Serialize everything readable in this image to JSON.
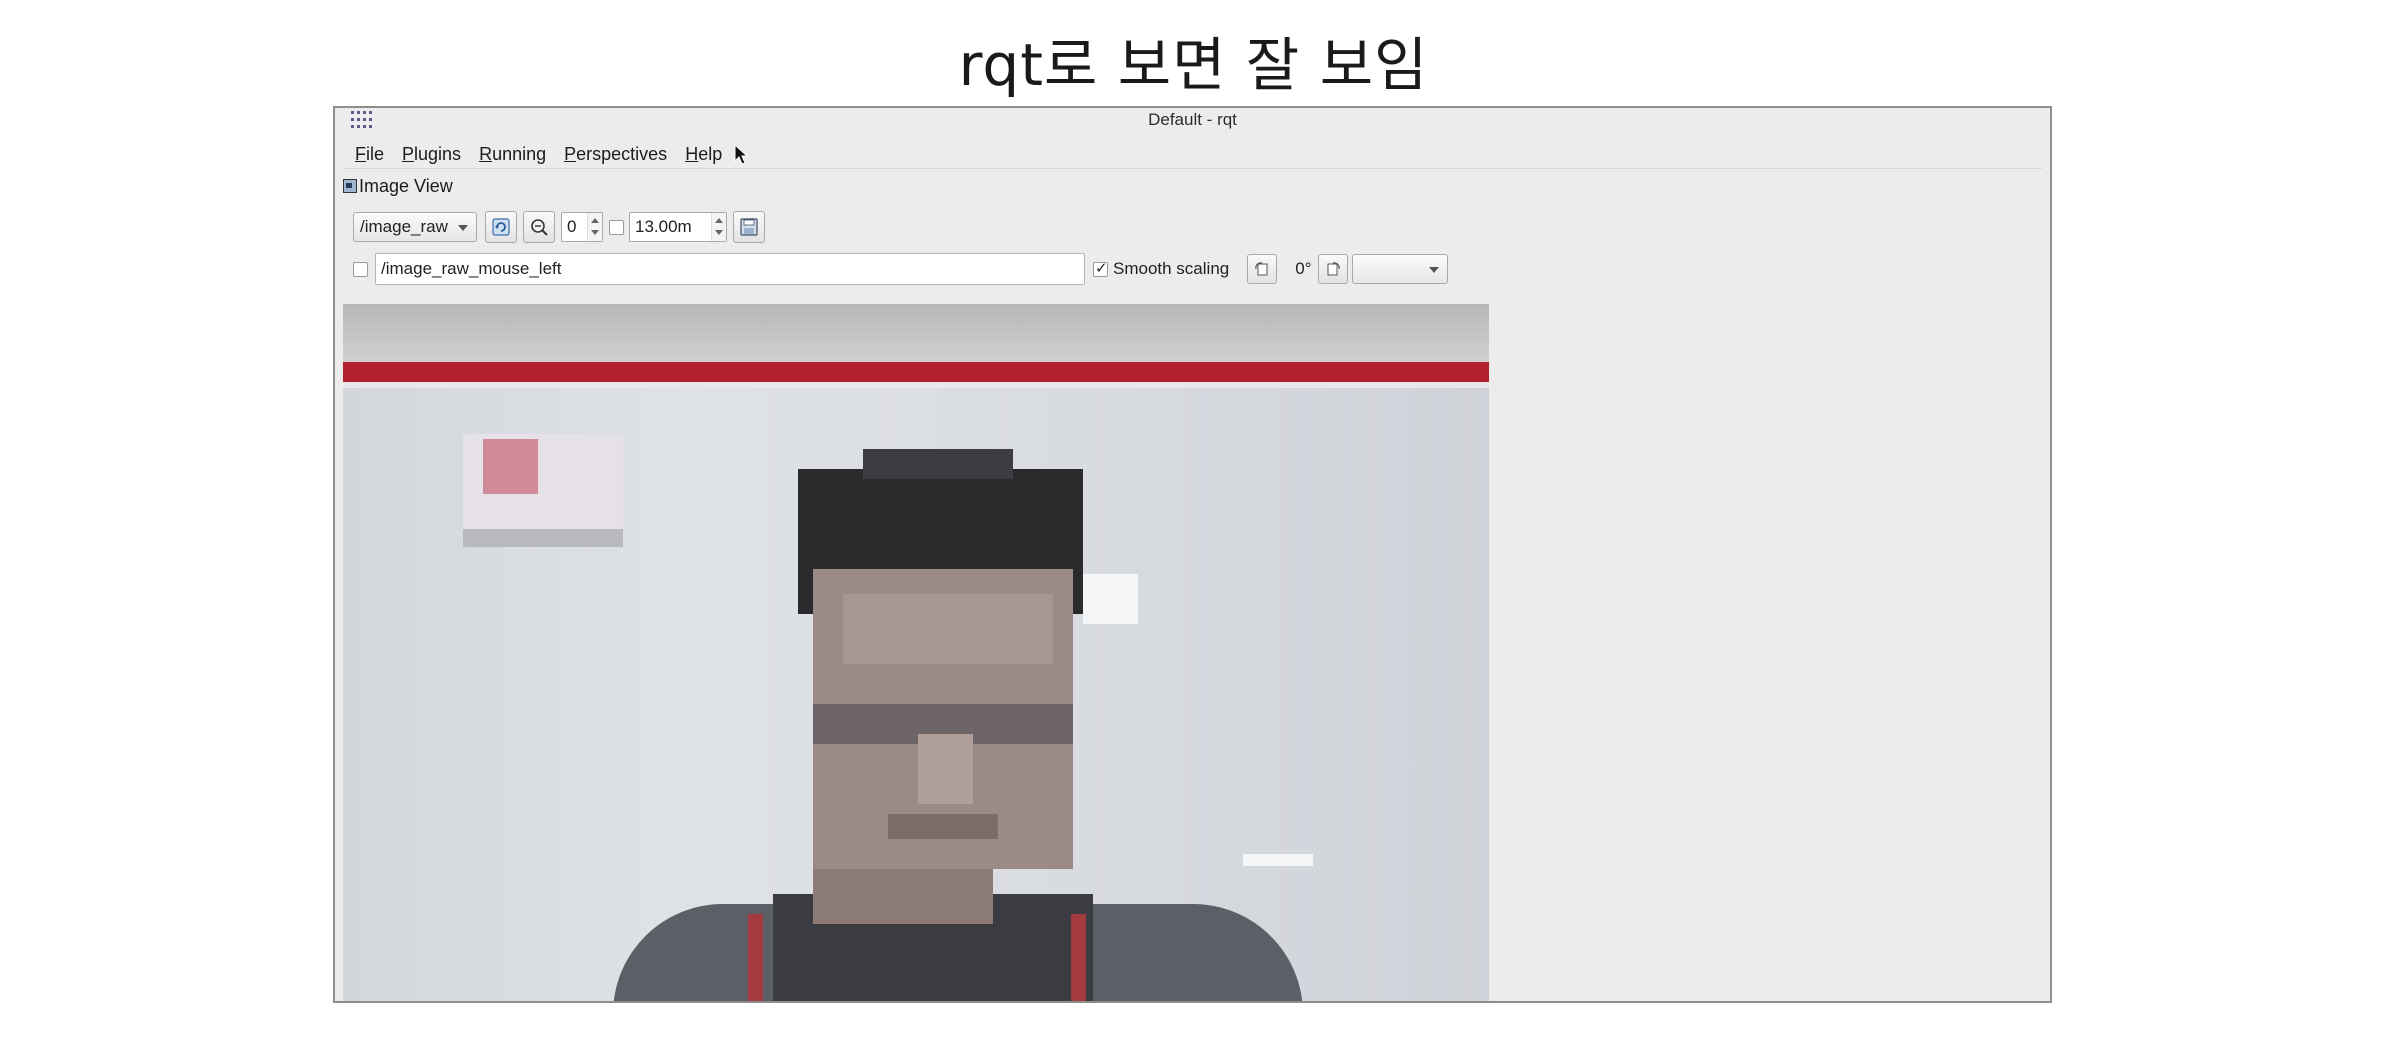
{
  "slide": {
    "title": "rqt로 보면 잘 보임"
  },
  "window": {
    "title": "Default - rqt"
  },
  "menu": {
    "items": [
      {
        "label": "File",
        "accel": "F",
        "rest": "ile"
      },
      {
        "label": "Plugins",
        "accel": "P",
        "rest": "lugins"
      },
      {
        "label": "Running",
        "accel": "R",
        "rest": "unning"
      },
      {
        "label": "Perspectives",
        "accel": "P",
        "rest": "erspectives"
      },
      {
        "label": "Help",
        "accel": "H",
        "rest": "elp"
      }
    ]
  },
  "plugin": {
    "title": "Image View"
  },
  "toolbar": {
    "topic": "/image_raw",
    "spin_value": "0",
    "duration": "13.00m",
    "mouse_topic": "/image_raw_mouse_left",
    "smooth_scaling_label": "Smooth scaling",
    "smooth_scaling_checked": true,
    "rotation": "0°",
    "rotation_select": ""
  },
  "icons": {
    "app_menu": "app-grid-icon",
    "refresh": "refresh-icon",
    "zoom": "zoom-icon",
    "save": "save-icon",
    "rotate_left": "rotate-left-icon",
    "rotate_right": "rotate-right-icon",
    "cursor": "mouse-pointer-icon",
    "plugin": "image-view-plugin-icon"
  }
}
